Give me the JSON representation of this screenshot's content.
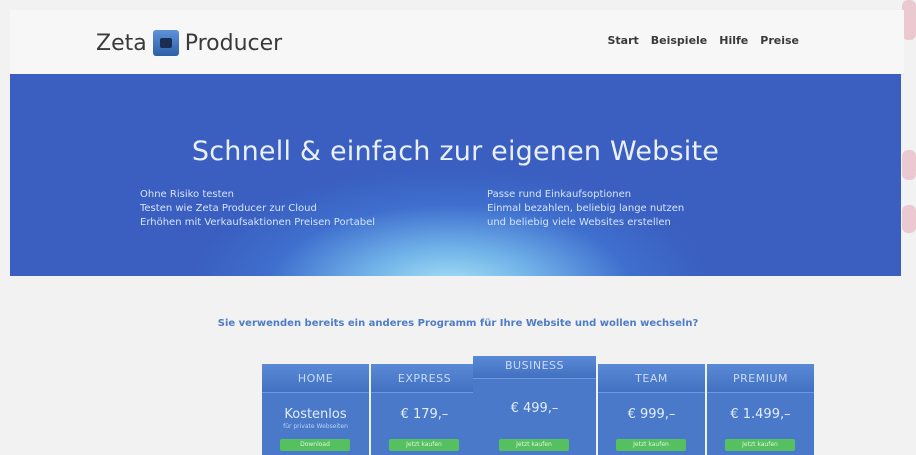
{
  "header": {
    "logo_left": "Zeta",
    "logo_right": "Producer",
    "nav": [
      "Start",
      "Beispiele",
      "Hilfe",
      "Preise"
    ]
  },
  "hero": {
    "title": "Schnell & einfach zur eigenen Website",
    "features_left": [
      "Ohne Risiko testen",
      "Testen wie Zeta Producer zur Cloud",
      "Erhöhen mit Verkaufsaktionen Preisen Portabel"
    ],
    "features_right": [
      "Passe rund Einkaufsoptionen",
      "Einmal bezahlen, beliebig lange nutzen",
      "und beliebig viele Websites erstellen"
    ]
  },
  "question": "Sie verwenden bereits ein anderes Programm für Ihre Website und wollen wechseln?",
  "plans": [
    {
      "name": "HOME",
      "price": "Kostenlos",
      "sub": "für private Webseiten",
      "button": "Download"
    },
    {
      "name": "EXPRESS",
      "price": "€ 179,–",
      "sub": "",
      "button": "Jetzt kaufen"
    },
    {
      "name": "BUSINESS",
      "price": "€ 499,–",
      "sub": "",
      "button": "Jetzt kaufen"
    },
    {
      "name": "TEAM",
      "price": "€ 999,–",
      "sub": "",
      "button": "Jetzt kaufen"
    },
    {
      "name": "PREMIUM",
      "price": "€ 1.499,–",
      "sub": "",
      "button": "Jetzt kaufen"
    }
  ],
  "colors": {
    "hero_blue": "#3a5fc0",
    "hero_glow": "#a9e6f6",
    "plan_blue": "#4a79c9",
    "cta_green": "#55c060",
    "link_blue": "#4f7cc6"
  },
  "icons": {
    "logo": "lock-box-icon"
  }
}
